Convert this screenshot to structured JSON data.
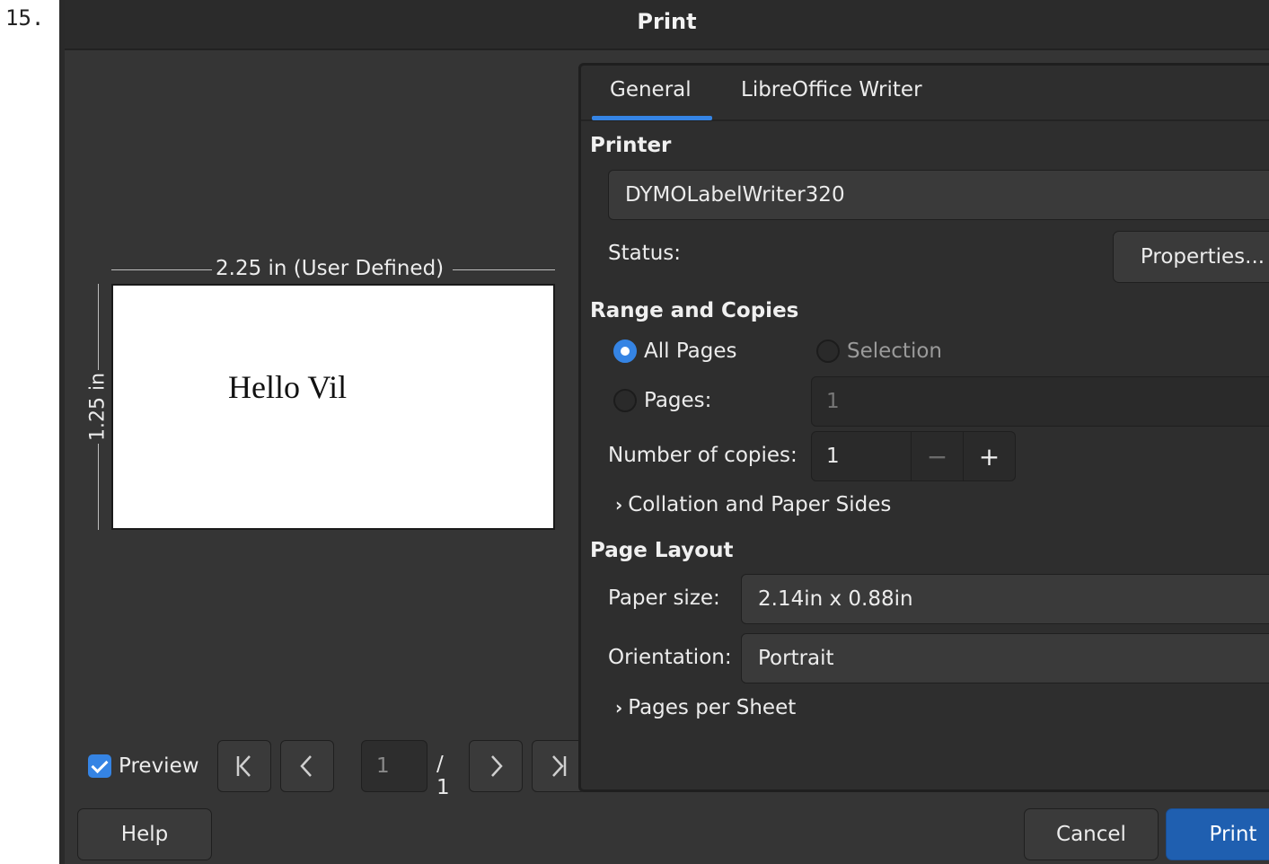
{
  "list_number": "15.",
  "dialog": {
    "title": "Print"
  },
  "preview": {
    "width_label": "2.25 in (User Defined)",
    "height_label": "1.25 in",
    "document_text": "Hello Vil",
    "checkbox_label": "Preview",
    "checkbox_checked": true,
    "page_input_value": "1",
    "page_total": "/ 1"
  },
  "tabs": [
    {
      "label": "General",
      "selected": true
    },
    {
      "label": "LibreOffice Writer",
      "selected": false
    }
  ],
  "printer": {
    "section_title": "Printer",
    "selected": "DYMOLabelWriter320",
    "status_label": "Status:",
    "properties_button": "Properties..."
  },
  "range": {
    "section_title": "Range and Copies",
    "all_pages": "All Pages",
    "selection": "Selection",
    "pages": "Pages:",
    "pages_value": "1",
    "copies_label": "Number of copies:",
    "copies_value": "1",
    "collation": "Collation and Paper Sides"
  },
  "layout": {
    "section_title": "Page Layout",
    "paper_size_label": "Paper size:",
    "paper_size_value": "2.14in x 0.88in",
    "orientation_label": "Orientation:",
    "orientation_value": "Portrait",
    "pages_per_sheet": "Pages per Sheet"
  },
  "buttons": {
    "help": "Help",
    "cancel": "Cancel",
    "print": "Print"
  },
  "colors": {
    "accent": "#3584e4",
    "dialog_bg": "#353535",
    "print_button": "#1f5fb0"
  }
}
